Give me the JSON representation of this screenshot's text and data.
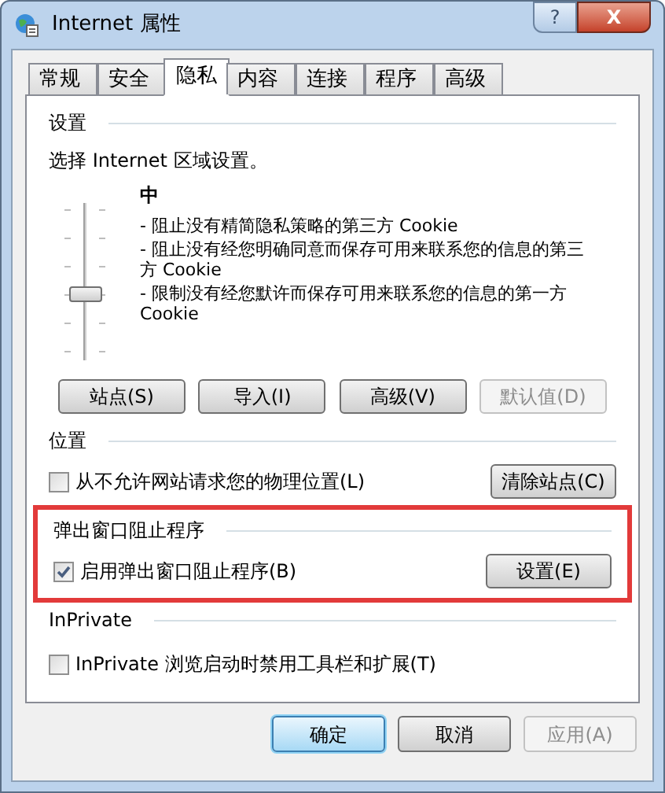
{
  "window": {
    "title": "Internet 属性",
    "buttons": [
      "?",
      "X"
    ]
  },
  "tabs": [
    {
      "label": "常规",
      "selected": false
    },
    {
      "label": "安全",
      "selected": false
    },
    {
      "label": "隐私",
      "selected": true
    },
    {
      "label": "内容",
      "selected": false
    },
    {
      "label": "连接",
      "selected": false
    },
    {
      "label": "程序",
      "selected": false
    },
    {
      "label": "高级",
      "selected": false
    }
  ],
  "settings": {
    "title": "设置",
    "prompt": "选择 Internet 区域设置。",
    "level_name": "中",
    "slider": {
      "level": 0.4
    },
    "descriptions": [
      "- 阻止没有精简隐私策略的第三方 Cookie",
      "- 阻止没有经您明确同意而保存可用来联系您的信息的第三方 Cookie",
      "- 限制没有经您默许而保存可用来联系您的信息的第一方 Cookie"
    ],
    "buttons": [
      {
        "label": "站点(S)",
        "disabled": false
      },
      {
        "label": "导入(I)",
        "disabled": false
      },
      {
        "label": "高级(V)",
        "disabled": false
      },
      {
        "label": "默认值(D)",
        "disabled": true
      }
    ]
  },
  "location": {
    "title": "位置",
    "checkbox": {
      "label": "从不允许网站请求您的物理位置(L)",
      "checked": false
    },
    "button": "清除站点(C)"
  },
  "popup_blocker": {
    "title": "弹出窗口阻止程序",
    "highlighted": true,
    "checkbox": {
      "label": "启用弹出窗口阻止程序(B)",
      "checked": true
    },
    "button": "设置(E)"
  },
  "inprivate": {
    "title": "InPrivate",
    "checkbox": {
      "label": "InPrivate 浏览启动时禁用工具栏和扩展(T)",
      "checked": false
    }
  },
  "footer": [
    {
      "label": "确定",
      "default": true,
      "disabled": false
    },
    {
      "label": "取消",
      "default": false,
      "disabled": false
    },
    {
      "label": "应用(A)",
      "default": false,
      "disabled": true
    }
  ]
}
